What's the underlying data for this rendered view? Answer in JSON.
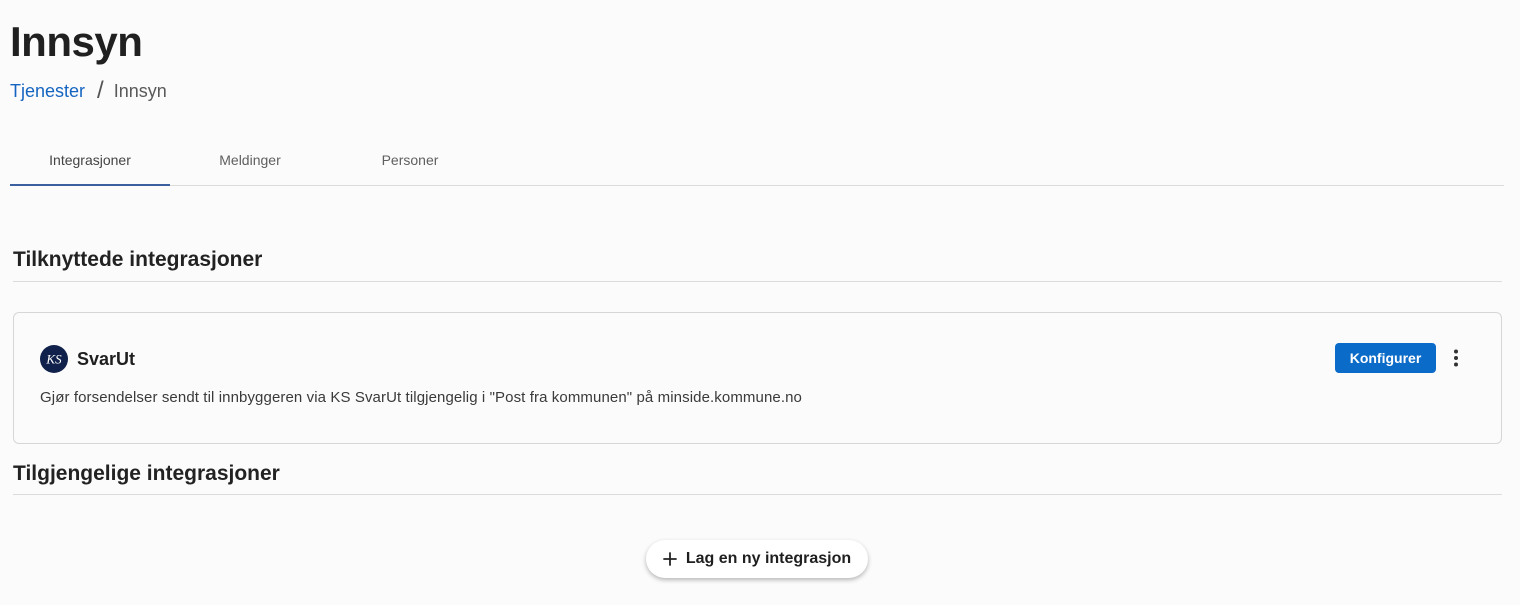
{
  "header": {
    "title": "Innsyn"
  },
  "breadcrumb": {
    "items": [
      "Tjenester",
      "Innsyn"
    ],
    "separator": "/"
  },
  "tabs": [
    {
      "label": "Integrasjoner",
      "active": true
    },
    {
      "label": "Meldinger",
      "active": false
    },
    {
      "label": "Personer",
      "active": false
    }
  ],
  "connected": {
    "title": "Tilknyttede integrasjoner",
    "items": [
      {
        "logo_text": "KS",
        "logo_icon": "ks-logo-icon",
        "name": "SvarUt",
        "description": "Gjør forsendelser sendt til innbyggeren via KS SvarUt tilgjengelig i \"Post fra kommunen\" på minside.kommune.no",
        "configure_label": "Konfigurer",
        "menu_icon": "more-vert-icon"
      }
    ]
  },
  "available": {
    "title": "Tilgjengelige integrasjoner",
    "new_button_label": "Lag en ny integrasjon",
    "new_button_icon": "plus-icon"
  },
  "colors": {
    "accent": "#0b6bc8",
    "link": "#1565c0",
    "tab_indicator": "#3b5f9f",
    "logo_background": "#10224b"
  }
}
